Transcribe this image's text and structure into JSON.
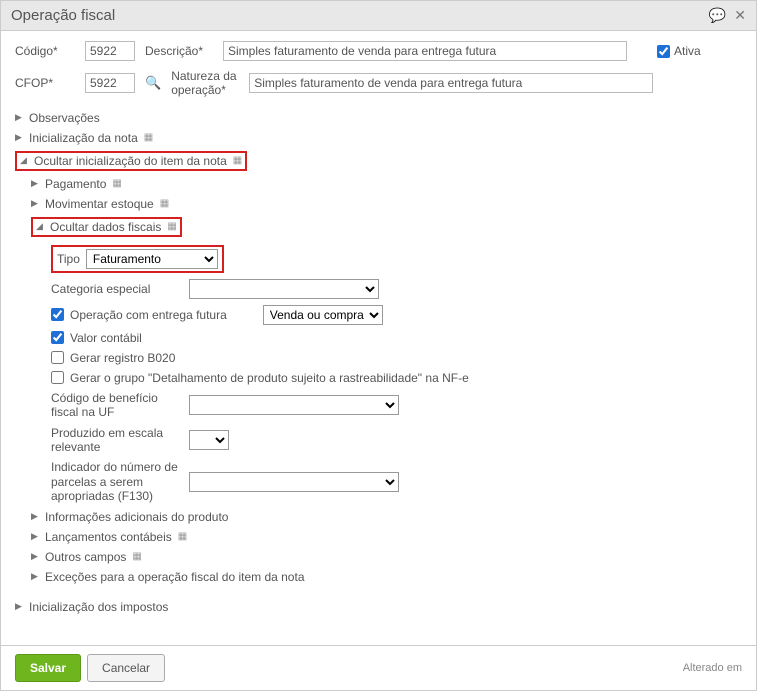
{
  "header": {
    "title": "Operação fiscal",
    "comment_icon": "💬",
    "close_icon": "✕"
  },
  "form": {
    "codigo_label": "Código*",
    "codigo_value": "5922",
    "cfop_label": "CFOP*",
    "cfop_value": "5922",
    "descricao_label": "Descrição*",
    "descricao_value": "Simples faturamento de venda para entrega futura",
    "natureza_label": "Natureza da operação*",
    "natureza_value": "Simples faturamento de venda para entrega futura",
    "ativa_label": "Ativa"
  },
  "tree": {
    "observacoes": "Observações",
    "init_nota": "Inicialização da nota",
    "ocultar_init_item": "Ocultar inicialização do item da nota",
    "pagamento": "Pagamento",
    "mov_estoque": "Movimentar estoque",
    "ocultar_dados_fiscais": "Ocultar dados fiscais",
    "info_adicionais": "Informações adicionais do produto",
    "lancamentos": "Lançamentos contábeis",
    "outros": "Outros campos",
    "excecoes": "Exceções para a operação fiscal do item da nota",
    "init_impostos": "Inicialização dos impostos"
  },
  "fiscal": {
    "tipo_label": "Tipo",
    "tipo_value": "Faturamento",
    "categoria_label": "Categoria especial",
    "op_entrega_futura": "Operação com entrega futura",
    "venda_compra": "Venda ou compra",
    "valor_contabil": "Valor contábil",
    "gerar_b020": "Gerar registro B020",
    "gerar_grupo": "Gerar o grupo \"Detalhamento de produto sujeito a rastreabilidade\" na NF-e",
    "codigo_beneficio": "Código de benefício fiscal na UF",
    "produzido_escala": "Produzido em escala relevante",
    "indicador_parcelas": "Indicador do número de parcelas a serem apropriadas (F130)"
  },
  "footer": {
    "salvar": "Salvar",
    "cancelar": "Cancelar",
    "alterado": "Alterado em"
  }
}
